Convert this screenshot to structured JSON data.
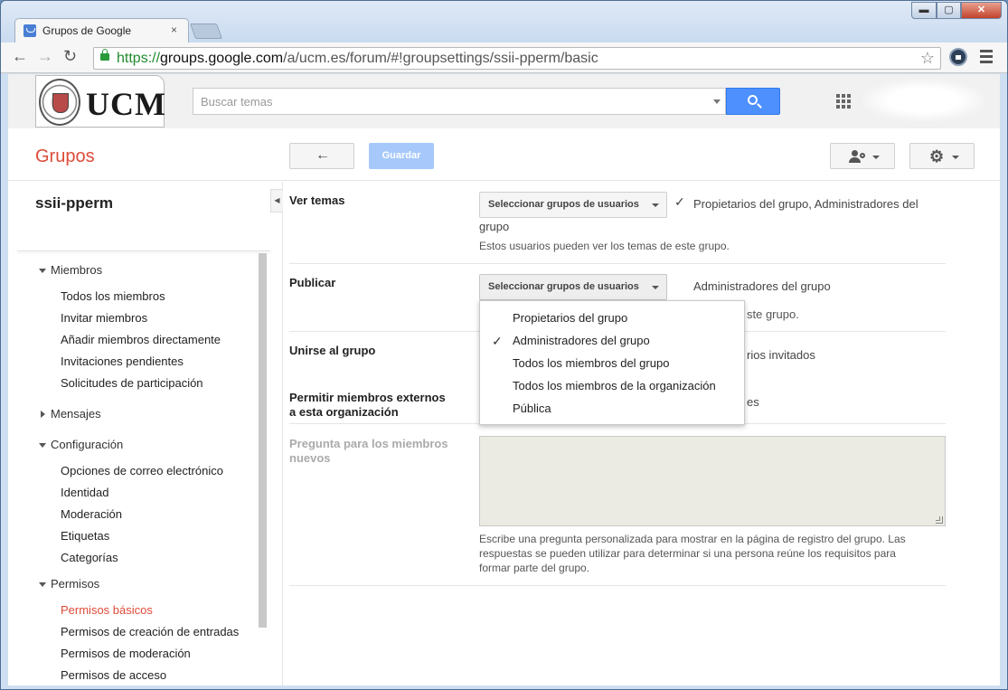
{
  "browser": {
    "tab_title": "Grupos de Google",
    "tab_close": "×",
    "url_scheme": "https://",
    "url_host": "groups.google.com",
    "url_path": "/a/ucm.es/forum/#!groupsettings/ssii-pperm/basic",
    "window_buttons": {
      "minimize": "▬",
      "maximize": "▢",
      "close": "✕"
    }
  },
  "header": {
    "logo_text": "UCM",
    "search_placeholder": "Buscar temas",
    "brand_color": "#dd4b39",
    "search_button_color": "#4d90fe"
  },
  "appbar": {
    "title": "Grupos",
    "back_icon": "←",
    "save_label": "Guardar",
    "gear_icon": "⚙"
  },
  "sidebar": {
    "group_name": "ssii-pperm",
    "sections": [
      {
        "label": "Miembros",
        "items": [
          "Todos los miembros",
          "Invitar miembros",
          "Añadir miembros directamente",
          "Invitaciones pendientes",
          "Solicitudes de participación"
        ]
      },
      {
        "label": "Mensajes",
        "items": []
      },
      {
        "label": "Configuración",
        "items": [
          "Opciones de correo electrónico",
          "Identidad",
          "Moderación",
          "Etiquetas",
          "Categorías"
        ]
      },
      {
        "label": "Permisos",
        "items": [
          "Permisos básicos",
          "Permisos de creación de entradas",
          "Permisos de moderación",
          "Permisos de acceso"
        ]
      }
    ],
    "active_item": "Permisos básicos"
  },
  "settings": {
    "ver_temas": {
      "label": "Ver temas",
      "select_label": "Seleccionar grupos de usuarios",
      "value_line1": "Propietarios del grupo, Administradores del",
      "value_line2": "grupo",
      "help": "Estos usuarios pueden ver los temas de este grupo."
    },
    "publicar": {
      "label": "Publicar",
      "select_label": "Seleccionar grupos de usuarios",
      "value": "Administradores del grupo",
      "help_partial": "ste grupo."
    },
    "unirse": {
      "label": "Unirse al grupo",
      "value_partial": "rios invitados"
    },
    "externos": {
      "label_line1": "Permitir miembros externos",
      "label_line2": "a esta organización",
      "value_partial": "es"
    },
    "pregunta": {
      "label_line1": "Pregunta para los miembros",
      "label_line2": "nuevos",
      "help_line1": "Escribe una pregunta personalizada para mostrar en la página de registro del grupo. Las",
      "help_line2": "respuestas se pueden utilizar para determinar si una persona reúne los requisitos para",
      "help_line3": "formar parte del grupo."
    }
  },
  "dropdown": {
    "options": [
      "Propietarios del grupo",
      "Administradores del grupo",
      "Todos los miembros del grupo",
      "Todos los miembros de la organización",
      "Pública"
    ],
    "checked": "Administradores del grupo",
    "check_icon": "✓"
  }
}
